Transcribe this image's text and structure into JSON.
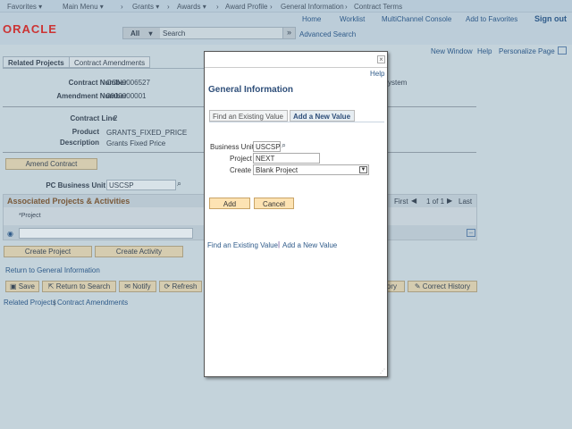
{
  "nav": {
    "favorites": "Favorites ▾",
    "main_menu": "Main Menu ▾",
    "crumbs": [
      "Grants ▾",
      "Awards ▾",
      "Award Profile",
      "General Information",
      "Contract Terms"
    ]
  },
  "header": {
    "links": [
      "Home",
      "Worklist",
      "MultiChannel Console",
      "Add to Favorites"
    ],
    "sign_out": "Sign out",
    "logo": "ORACLE",
    "search_scope": "All",
    "search_placeholder": "Search",
    "advanced_search": "Advanced Search"
  },
  "pagebar": {
    "new_window": "New Window",
    "help": "Help",
    "personalize": "Personalize Page"
  },
  "tabs": [
    "Related Projects",
    "Contract Amendments"
  ],
  "fields": {
    "contract_number_label": "Contract Number",
    "contract_number": "CON0006527",
    "amendment_number_label": "Amendment Number",
    "amendment_number": "0000000001",
    "contract_line_label": "Contract Line",
    "contract_line": "2",
    "product_label": "Product",
    "product": "GRANTS_FIXED_PRICE",
    "description_label": "Description",
    "description": "Grants Fixed Price",
    "partial_text": "ystem"
  },
  "amend_button": "Amend Contract",
  "pc_bu_label": "PC Business Unit",
  "pc_bu": "USCSP",
  "grid": {
    "title": "Associated Projects & Activities",
    "col_project": "*Project",
    "first": "First",
    "count": "1 of 1",
    "last": "Last"
  },
  "create_project": "Create Project",
  "create_activity": "Create Activity",
  "return_link": "Return to General Information",
  "toolbar": {
    "save": "Save",
    "return_search": "Return to Search",
    "notify": "Notify",
    "refresh": "Refresh",
    "partial": "ory",
    "correct_history": "Correct History"
  },
  "footer_links": [
    "Related Projects",
    "Contract Amendments"
  ],
  "modal": {
    "close": "×",
    "help": "Help",
    "title": "General Information",
    "tab_find": "Find an Existing Value",
    "tab_add": "Add a New Value",
    "bu_label": "Business Unit",
    "bu": "USCSP",
    "project_label": "Project",
    "project": "NEXT",
    "create_label": "Create",
    "create": "Blank Project",
    "add": "Add",
    "cancel": "Cancel",
    "link_find": "Find an Existing Value",
    "link_add": "Add a New Value"
  }
}
